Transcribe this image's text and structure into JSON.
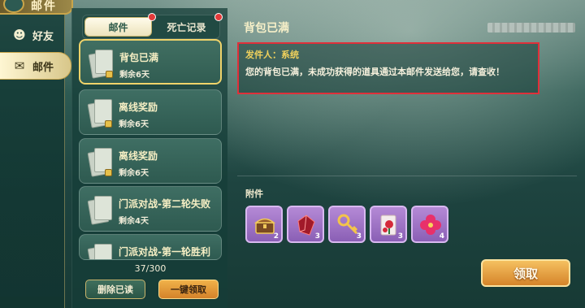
{
  "header": {
    "title": "邮件"
  },
  "nav": {
    "items": [
      {
        "label": "好友",
        "icon": "friends-icon"
      },
      {
        "label": "邮件",
        "icon": "mail-icon",
        "active": true
      }
    ]
  },
  "tabs": [
    {
      "label": "邮件",
      "active": true
    },
    {
      "label": "死亡记录",
      "active": false
    }
  ],
  "mails": [
    {
      "title": "背包已满",
      "remaining": "剩余6天",
      "selected": true
    },
    {
      "title": "离线奖励",
      "remaining": "剩余6天"
    },
    {
      "title": "离线奖励",
      "remaining": "剩余6天"
    },
    {
      "title": "门派对战-第二轮失败",
      "remaining": "剩余4天"
    },
    {
      "title": "门派对战-第一轮胜利",
      "remaining": ""
    }
  ],
  "mail_count": "37/300",
  "buttons": {
    "delete_read": "删除已读",
    "claim_all": "一键领取",
    "claim": "领取"
  },
  "detail": {
    "title": "背包已满",
    "sender": "发件人：系统",
    "body": "您的背包已满，未成功获得的道具通过本邮件发送给您，请查收！"
  },
  "attachments": {
    "label": "附件",
    "items": [
      {
        "icon": "treasure-chest-icon",
        "quantity": "2"
      },
      {
        "icon": "red-crystal-icon",
        "quantity": "3"
      },
      {
        "icon": "golden-key-icon",
        "quantity": "3"
      },
      {
        "icon": "rose-card-icon",
        "quantity": "3"
      },
      {
        "icon": "pink-flower-icon",
        "quantity": "4"
      }
    ]
  },
  "colors": {
    "accent": "#f0d36a",
    "highlight_border": "#e0303a",
    "claim_button": "#e09a38"
  }
}
